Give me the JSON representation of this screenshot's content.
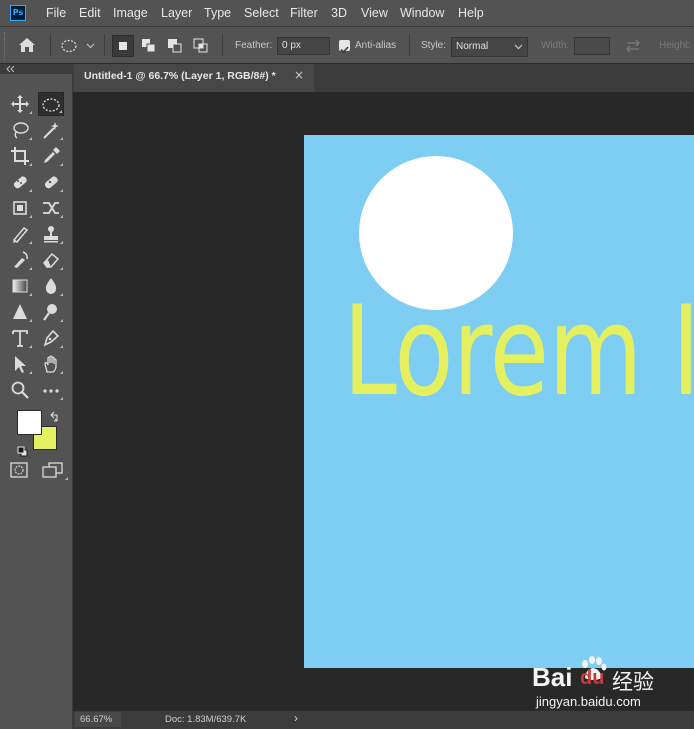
{
  "app": {
    "logo_text": "Ps"
  },
  "menu": [
    "File",
    "Edit",
    "Image",
    "Layer",
    "Type",
    "Select",
    "Filter",
    "3D",
    "View",
    "Window",
    "Help"
  ],
  "options": {
    "feather_label": "Feather:",
    "feather_value": "0 px",
    "antialias_label": "Anti-alias",
    "antialias_checked": true,
    "style_label": "Style:",
    "style_value": "Normal",
    "width_label": "Width:",
    "height_label": "Height:"
  },
  "tab": {
    "title": "Untitled-1 @ 66.7% (Layer 1, RGB/8#) *",
    "close": "×"
  },
  "canvas": {
    "text": "Lorem Ipsu",
    "background_color": "#7ecdf2",
    "circle_color": "#ffffff",
    "text_color": "#e4f060"
  },
  "swatches": {
    "foreground": "#ffffff",
    "background": "#e4f060"
  },
  "tools": [
    "move-tool-icon",
    "elliptical-marquee-tool-icon",
    "lasso-tool-icon",
    "magic-wand-tool-icon",
    "crop-tool-icon",
    "eyedropper-tool-icon",
    "spot-healing-brush-icon",
    "healing-brush-icon",
    "patch-tool-icon",
    "content-aware-move-icon",
    "brush-tool-icon",
    "clone-stamp-icon",
    "history-brush-icon",
    "eraser-tool-icon",
    "gradient-tool-icon",
    "blur-tool-icon",
    "sharpen-tool-icon",
    "dodge-tool-icon",
    "type-tool-icon",
    "pen-tool-icon",
    "path-selection-tool-icon",
    "hand-rotate-tool-icon",
    "zoom-tool-icon",
    "more-tools-icon"
  ],
  "status": {
    "zoom": "66.67%",
    "doc": "Doc: 1.83M/639.7K",
    "arrow": "›"
  },
  "watermark": {
    "brand": "Bai",
    "brand2": "du",
    "cn": "经验",
    "url": "jingyan.baidu.com"
  }
}
